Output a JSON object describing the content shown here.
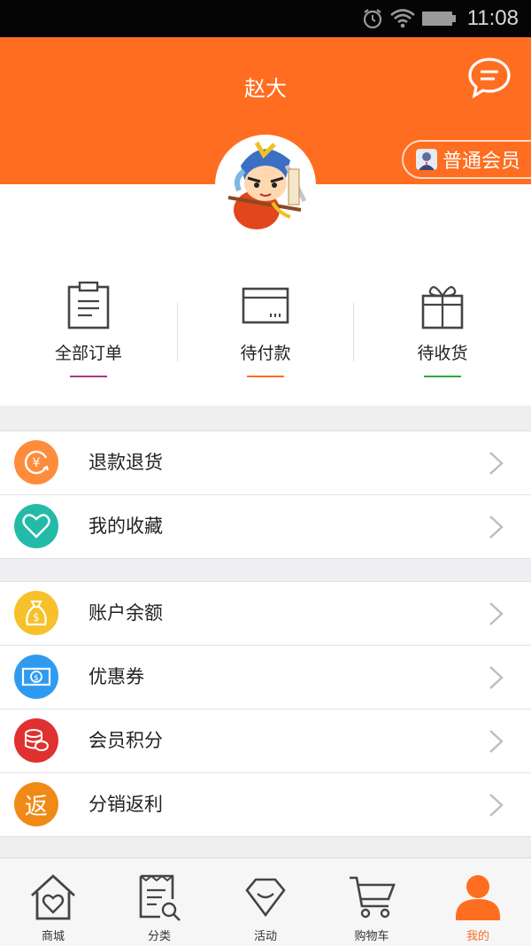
{
  "status_bar": {
    "time": "11:08"
  },
  "header": {
    "title": "赵大",
    "member_badge": "普通会员"
  },
  "orders": [
    {
      "label": "全部订单",
      "icon": "clipboard-icon",
      "accent": "#b0387a"
    },
    {
      "label": "待付款",
      "icon": "card-icon",
      "accent": "#ff6d20"
    },
    {
      "label": "待收货",
      "icon": "gift-icon",
      "accent": "#2eaa3c"
    }
  ],
  "menu_group_1": [
    {
      "label": "退款退货",
      "icon": "refund-icon",
      "color": "#ff8c3b"
    },
    {
      "label": "我的收藏",
      "icon": "heart-icon",
      "color": "#23bba8"
    }
  ],
  "menu_group_2": [
    {
      "label": "账户余额",
      "icon": "money-bag-icon",
      "color": "#f6c12a"
    },
    {
      "label": "优惠券",
      "icon": "coupon-icon",
      "color": "#2e9bf0"
    },
    {
      "label": "会员积分",
      "icon": "coins-icon",
      "color": "#e03030"
    },
    {
      "label": "分销返利",
      "icon": "rebate-icon",
      "color": "#f08a16",
      "glyph": "返"
    }
  ],
  "tabbar": [
    {
      "label": "商城",
      "icon": "home-heart-icon"
    },
    {
      "label": "分类",
      "icon": "receipt-search-icon"
    },
    {
      "label": "活动",
      "icon": "diamond-icon"
    },
    {
      "label": "购物车",
      "icon": "cart-icon"
    },
    {
      "label": "我的",
      "icon": "user-icon",
      "active": true
    }
  ],
  "colors": {
    "brand": "#ff6d20",
    "background": "#efeff1"
  }
}
